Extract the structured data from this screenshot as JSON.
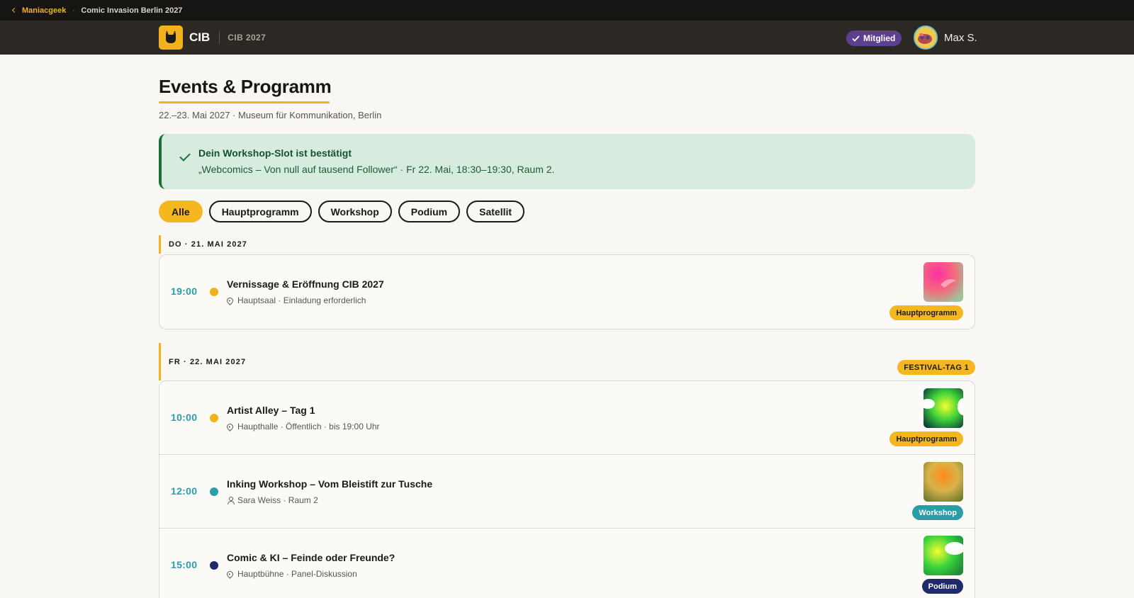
{
  "topbar": {
    "back_label": "Maniacgeek",
    "separator": "·",
    "crumb": "Comic Invasion Berlin 2027"
  },
  "header": {
    "brand_name": "CIB",
    "brand_sub": "CIB 2027",
    "member_badge": "Mitglied",
    "user_name": "Max S."
  },
  "page": {
    "title": "Events & Programm",
    "subtitle": "22.–23. Mai 2027 · Museum für Kommunikation, Berlin"
  },
  "notice": {
    "title": "Dein Workshop-Slot ist bestätigt",
    "text": "„Webcomics – Von null auf tausend Follower“ · Fr 22. Mai, 18:30–19:30, Raum 2."
  },
  "filters": [
    "Alle",
    "Hauptprogramm",
    "Workshop",
    "Podium",
    "Satellit"
  ],
  "days": [
    {
      "label": "DO · 21. MAI 2027",
      "badge": "",
      "events": [
        {
          "time": "19:00",
          "title": "Vernissage & Eröffnung CIB 2027",
          "meta": "Hauptsaal · Einladung erforderlich",
          "meta_icon": "location-pin-icon",
          "tag": "Hauptprogramm",
          "dot_color": "#f2b21b",
          "tag_bg": "#f5b720",
          "tag_fg": "#1c1a17"
        }
      ]
    },
    {
      "label": "FR · 22. MAI 2027",
      "badge": "FESTIVAL-TAG 1",
      "events": [
        {
          "time": "10:00",
          "title": "Artist Alley – Tag 1",
          "meta": "Haupthalle · Öffentlich · bis 19:00 Uhr",
          "meta_icon": "location-pin-icon",
          "tag": "Hauptprogramm",
          "dot_color": "#f2b21b",
          "tag_bg": "#f5b720",
          "tag_fg": "#1c1a17"
        },
        {
          "time": "12:00",
          "title": "Inking Workshop – Vom Bleistift zur Tusche",
          "meta": "Sara Weiss · Raum 2",
          "meta_icon": "person-icon",
          "tag": "Workshop",
          "dot_color": "#2a9da7",
          "tag_bg": "#2a9da7",
          "tag_fg": "#ffffff"
        },
        {
          "time": "15:00",
          "title": "Comic & KI – Feinde oder Freunde?",
          "meta": "Hauptbühne · Panel-Diskussion",
          "meta_icon": "location-pin-icon",
          "tag": "Podium",
          "dot_color": "#1f2a68",
          "tag_bg": "#1f2a68",
          "tag_fg": "#ffffff"
        }
      ]
    }
  ]
}
